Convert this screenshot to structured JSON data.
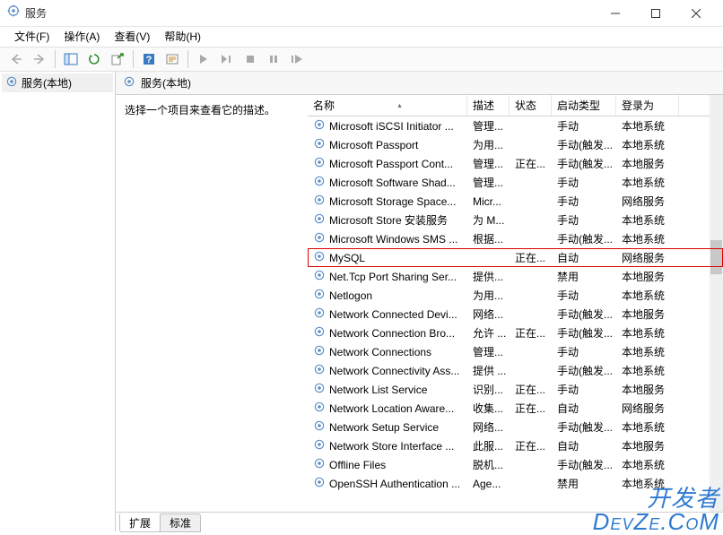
{
  "window": {
    "title": "服务"
  },
  "menu": {
    "file": "文件(F)",
    "action": "操作(A)",
    "view": "查看(V)",
    "help": "帮助(H)"
  },
  "tree": {
    "root": "服务(本地)"
  },
  "pane": {
    "title": "服务(本地)",
    "desc_prompt": "选择一个项目来查看它的描述。"
  },
  "columns": {
    "name": "名称",
    "desc": "描述",
    "status": "状态",
    "startup": "启动类型",
    "logon": "登录为"
  },
  "tabs": {
    "ext": "扩展",
    "std": "标准"
  },
  "rows": [
    {
      "name": "Microsoft iSCSI Initiator ...",
      "desc": "管理...",
      "status": "",
      "startup": "手动",
      "logon": "本地系统"
    },
    {
      "name": "Microsoft Passport",
      "desc": "为用...",
      "status": "",
      "startup": "手动(触发...",
      "logon": "本地系统"
    },
    {
      "name": "Microsoft Passport Cont...",
      "desc": "管理...",
      "status": "正在...",
      "startup": "手动(触发...",
      "logon": "本地服务"
    },
    {
      "name": "Microsoft Software Shad...",
      "desc": "管理...",
      "status": "",
      "startup": "手动",
      "logon": "本地系统"
    },
    {
      "name": "Microsoft Storage Space...",
      "desc": "Micr...",
      "status": "",
      "startup": "手动",
      "logon": "网络服务"
    },
    {
      "name": "Microsoft Store 安装服务",
      "desc": "为 M...",
      "status": "",
      "startup": "手动",
      "logon": "本地系统"
    },
    {
      "name": "Microsoft Windows SMS ...",
      "desc": "根据...",
      "status": "",
      "startup": "手动(触发...",
      "logon": "本地系统"
    },
    {
      "name": "MySQL",
      "desc": "",
      "status": "正在...",
      "startup": "自动",
      "logon": "网络服务",
      "hl": true
    },
    {
      "name": "Net.Tcp Port Sharing Ser...",
      "desc": "提供...",
      "status": "",
      "startup": "禁用",
      "logon": "本地服务"
    },
    {
      "name": "Netlogon",
      "desc": "为用...",
      "status": "",
      "startup": "手动",
      "logon": "本地系统"
    },
    {
      "name": "Network Connected Devi...",
      "desc": "网络...",
      "status": "",
      "startup": "手动(触发...",
      "logon": "本地服务"
    },
    {
      "name": "Network Connection Bro...",
      "desc": "允许 ...",
      "status": "正在...",
      "startup": "手动(触发...",
      "logon": "本地系统"
    },
    {
      "name": "Network Connections",
      "desc": "管理...",
      "status": "",
      "startup": "手动",
      "logon": "本地系统"
    },
    {
      "name": "Network Connectivity Ass...",
      "desc": "提供 ...",
      "status": "",
      "startup": "手动(触发...",
      "logon": "本地系统"
    },
    {
      "name": "Network List Service",
      "desc": "识别...",
      "status": "正在...",
      "startup": "手动",
      "logon": "本地服务"
    },
    {
      "name": "Network Location Aware...",
      "desc": "收集...",
      "status": "正在...",
      "startup": "自动",
      "logon": "网络服务"
    },
    {
      "name": "Network Setup Service",
      "desc": "网络...",
      "status": "",
      "startup": "手动(触发...",
      "logon": "本地系统"
    },
    {
      "name": "Network Store Interface ...",
      "desc": "此服...",
      "status": "正在...",
      "startup": "自动",
      "logon": "本地服务"
    },
    {
      "name": "Offline Files",
      "desc": "脱机...",
      "status": "",
      "startup": "手动(触发...",
      "logon": "本地系统"
    },
    {
      "name": "OpenSSH Authentication ...",
      "desc": "Age...",
      "status": "",
      "startup": "禁用",
      "logon": "本地系统"
    }
  ],
  "watermark": {
    "l1": "开发者",
    "l2": "DevZe.CoM"
  }
}
